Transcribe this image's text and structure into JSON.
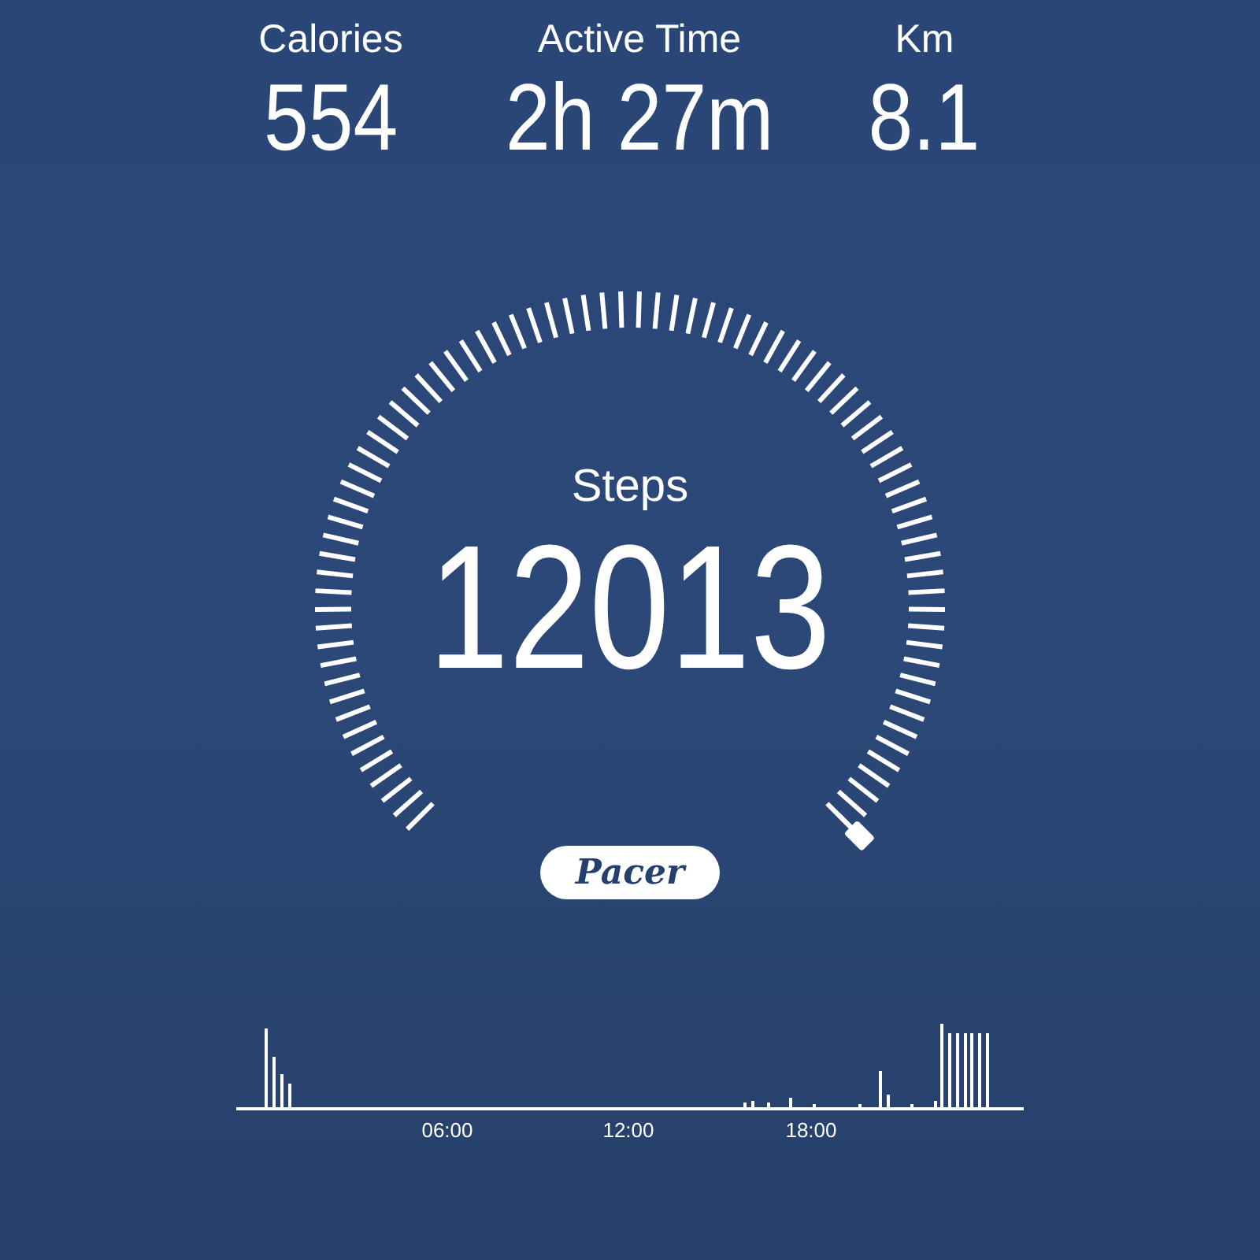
{
  "stats": [
    {
      "label": "Calories",
      "value": "554"
    },
    {
      "label": "Active Time",
      "value": "2h 27m"
    },
    {
      "label": "Km",
      "value": "8.1"
    }
  ],
  "gauge": {
    "label": "Steps",
    "value": "12013"
  },
  "brand": "Pacer",
  "activity": {
    "time_labels": [
      "06:00",
      "12:00",
      "18:00"
    ]
  }
}
